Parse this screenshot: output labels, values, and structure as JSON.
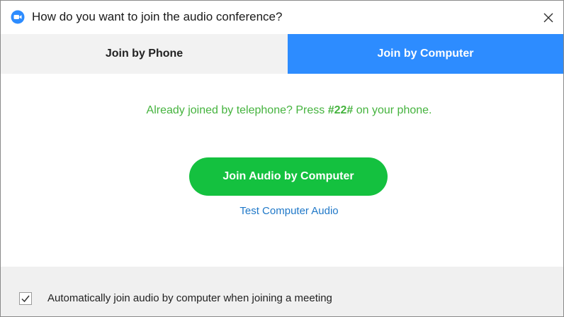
{
  "window": {
    "title": "How do you want to join the audio conference?"
  },
  "tabs": [
    {
      "label": "Join by Phone",
      "selected": false
    },
    {
      "label": "Join by Computer",
      "selected": true
    }
  ],
  "notice": {
    "prefix": "Already joined by telephone? Press ",
    "code": "#22#",
    "suffix": " on your phone."
  },
  "buttons": {
    "join_audio": "Join Audio by Computer",
    "test_audio": "Test Computer Audio"
  },
  "footer": {
    "auto_join_label": "Automatically join audio by computer when joining a meeting",
    "auto_join_checked": true
  },
  "colors": {
    "accent_blue": "#2d8cff",
    "join_green": "#14c13f",
    "notice_green": "#45b33e",
    "link_blue": "#1f78c8"
  },
  "icons": {
    "app": "zoom-logo-icon",
    "close": "close-icon",
    "check": "checkmark-icon"
  }
}
